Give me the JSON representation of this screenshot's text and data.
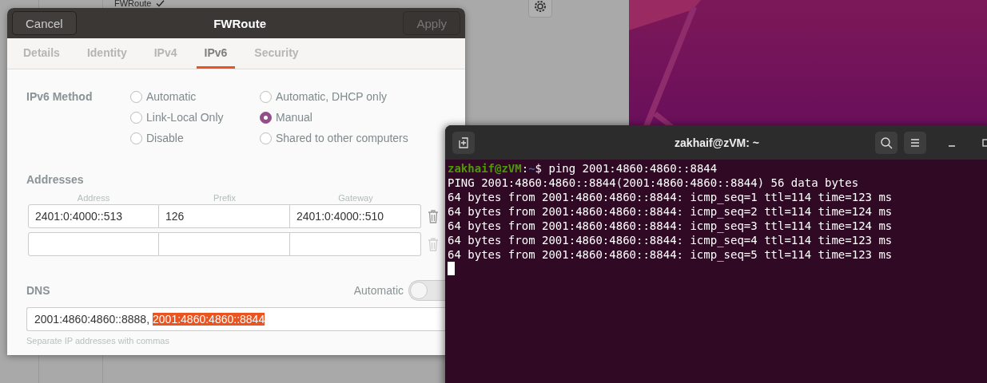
{
  "background_window": {
    "title": "FWRoute"
  },
  "dialog": {
    "title": "FWRoute",
    "cancel": "Cancel",
    "apply": {
      "label": "Apply",
      "disabled": true
    },
    "tabs": [
      {
        "label": "Details",
        "selected": false
      },
      {
        "label": "Identity",
        "selected": false
      },
      {
        "label": "IPv4",
        "selected": false
      },
      {
        "label": "IPv6",
        "selected": true
      },
      {
        "label": "Security",
        "selected": false
      }
    ],
    "method": {
      "label": "IPv6 Method",
      "options": [
        {
          "label": "Automatic",
          "selected": false
        },
        {
          "label": "Automatic, DHCP only",
          "selected": false
        },
        {
          "label": "Link-Local Only",
          "selected": false
        },
        {
          "label": "Manual",
          "selected": true
        },
        {
          "label": "Disable",
          "selected": false
        },
        {
          "label": "Shared to other computers",
          "selected": false
        }
      ]
    },
    "addresses": {
      "label": "Addresses",
      "columns": [
        "Address",
        "Prefix",
        "Gateway"
      ],
      "rows": [
        {
          "address": "2401:0:4000::513",
          "prefix": "126",
          "gateway": "2401:0:4000::510",
          "disabled": false
        },
        {
          "disabled": true
        }
      ]
    },
    "dns": {
      "label": "DNS",
      "automatic_label": "Automatic",
      "automatic_on": false,
      "value_parts": [
        {
          "text": "2001:4860:4860::8888,",
          "selected": false
        },
        {
          "text": "2001:4860:4860::8844",
          "selected": true
        }
      ],
      "hint": "Separate IP addresses with commas"
    }
  },
  "terminal": {
    "title": "zakhaif@zVM: ~",
    "prompt": [
      {
        "text": "zakhaif@zVM",
        "kind": "user"
      },
      {
        "text": ":",
        "kind": "plain"
      },
      {
        "text": "~",
        "kind": "path"
      },
      {
        "text": "$ ping 2001:4860:4860::8844",
        "kind": "plain"
      }
    ],
    "lines": [
      "PING 2001:4860:4860::8844(2001:4860:4860::8844) 56 data bytes",
      "64 bytes from 2001:4860:4860::8844: icmp_seq=1 ttl=114 time=123 ms",
      "64 bytes from 2001:4860:4860::8844: icmp_seq=2 ttl=114 time=124 ms",
      "64 bytes from 2001:4860:4860::8844: icmp_seq=3 ttl=114 time=124 ms",
      "64 bytes from 2001:4860:4860::8844: icmp_seq=4 ttl=114 time=123 ms",
      "64 bytes from 2001:4860:4860::8844: icmp_seq=5 ttl=114 time=123 ms"
    ]
  }
}
